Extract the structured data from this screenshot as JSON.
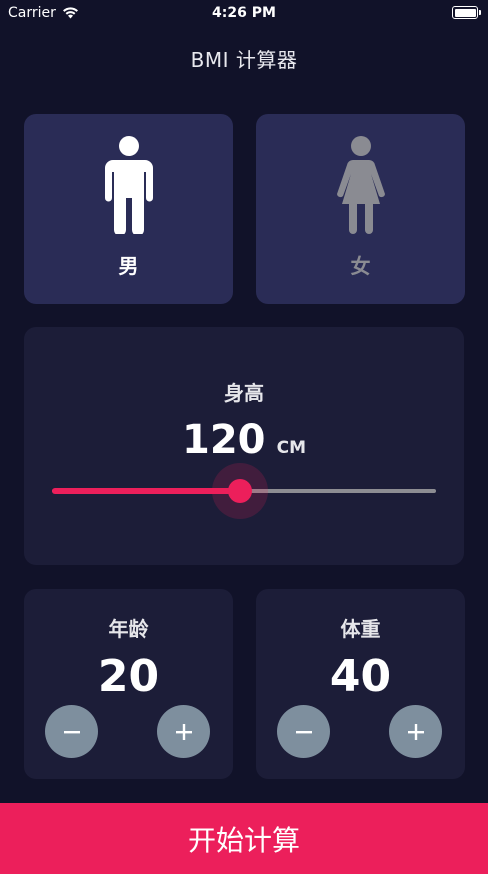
{
  "status_bar": {
    "carrier": "Carrier",
    "time": "4:26 PM",
    "wifi_icon": "wifi-icon",
    "battery_icon": "battery-icon"
  },
  "nav": {
    "title": "BMI 计算器"
  },
  "gender": {
    "male": {
      "label": "男",
      "icon": "male-icon",
      "selected": true
    },
    "female": {
      "label": "女",
      "icon": "female-icon",
      "selected": false
    }
  },
  "height": {
    "title": "身高",
    "value": "120",
    "unit": "CM",
    "slider_fraction": 0.49
  },
  "age": {
    "title": "年龄",
    "value": "20",
    "minus_label": "−",
    "plus_label": "+"
  },
  "weight": {
    "title": "体重",
    "value": "40",
    "minus_label": "−",
    "plus_label": "+"
  },
  "calculate_button": {
    "label": "开始计算"
  },
  "colors": {
    "background": "#111229",
    "card_active": "#2a2c56",
    "card_inactive": "#1c1d38",
    "accent": "#ec1f5b",
    "stepper": "#7e8f9e",
    "muted": "#8a8b92"
  }
}
